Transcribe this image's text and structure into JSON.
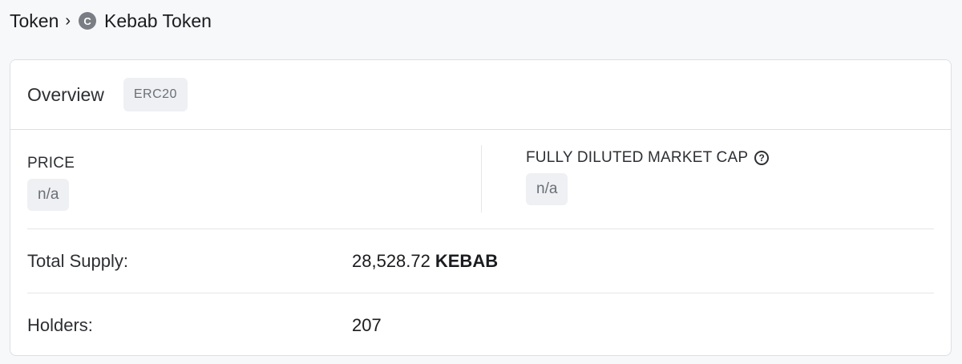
{
  "breadcrumb": {
    "root": "Token",
    "separator": "›",
    "token_logo_letter": "C",
    "token_name": "Kebab Token"
  },
  "overview": {
    "title": "Overview",
    "badge": "ERC20"
  },
  "stats": {
    "price_label": "PRICE",
    "price_value": "n/a",
    "market_cap_label": "FULLY DILUTED MARKET CAP",
    "market_cap_value": "n/a"
  },
  "details": {
    "total_supply_label": "Total Supply:",
    "total_supply_value": "28,528.72",
    "total_supply_unit": "KEBAB",
    "holders_label": "Holders:",
    "holders_value": "207"
  },
  "icons": {
    "help": "?",
    "token_logo": "token-logo-icon"
  }
}
